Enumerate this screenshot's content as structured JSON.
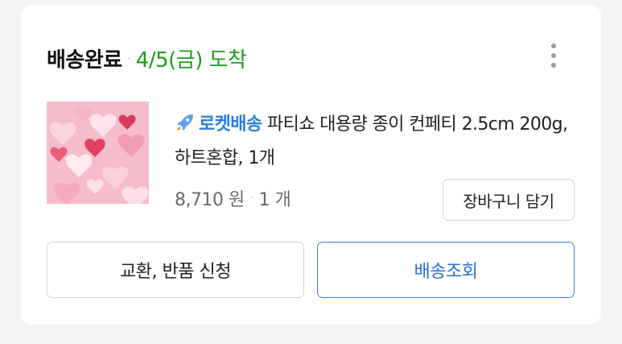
{
  "order": {
    "status": "배송완료",
    "arrival": "4/5(금) 도착"
  },
  "product": {
    "badge_label": "로켓배송",
    "name": "파티쇼 대용량 종이 컨페티 2.5cm 200g, 하트혼합, 1개",
    "price": "8,710 원",
    "quantity": "1 개"
  },
  "buttons": {
    "add_to_cart": "장바구니 담기",
    "exchange_return": "교환, 반품 신청",
    "track_delivery": "배송조회"
  },
  "icons": {
    "more": "more-vertical-icon",
    "rocket": "rocket-icon",
    "thumbnail": "heart-confetti-product-image"
  },
  "colors": {
    "arrival": "#1b9e1b",
    "rocket_label": "#2a7de1",
    "track_button": "#3f7de6"
  }
}
